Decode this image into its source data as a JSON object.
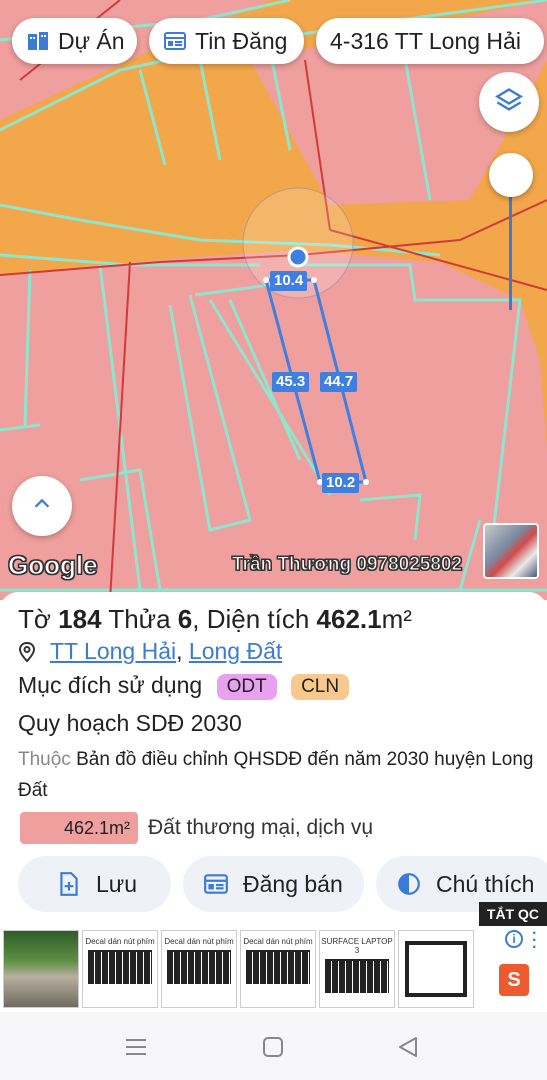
{
  "chips": [
    {
      "label": "Dự Án",
      "icon": "buildings-icon"
    },
    {
      "label": "Tin Đăng",
      "icon": "listing-icon"
    },
    {
      "label": "4-316 TT Long Hải"
    }
  ],
  "map": {
    "dimensions": {
      "top": "10.4",
      "left": "45.3",
      "right": "44.7",
      "bottom": "10.2"
    },
    "google_label": "Google",
    "watermark": "Trần Thương 0978025802",
    "colors": {
      "residential_zone": "#ef9f9d",
      "agricultural_zone": "#f2a74a",
      "parcel_outline": "#8fe6cf",
      "selection": "#3f7fe0"
    }
  },
  "parcel": {
    "to_label": "Tờ",
    "to": "184",
    "thua_label": "Thửa",
    "thua": "6",
    "dien_tich_label": ", Diện tích",
    "area": "462.1",
    "area_unit": "m²",
    "ward": "TT Long Hải",
    "address_sep": ", ",
    "district": "Long Đất",
    "muc_dich_label": "Mục đích sử dụng",
    "tags": [
      "ODT",
      "CLN"
    ],
    "plan_title": "Quy hoạch SDĐ 2030",
    "thuoc_label": "Thuộc",
    "plan_source": "Bản đồ điều chỉnh QHSDĐ đến năm 2030 huyện Long Đất",
    "usage_area": "462.1m²",
    "usage_desc": "Đất thương mại, dịch vụ"
  },
  "actions": [
    "Lưu",
    "Đăng bán",
    "Chú thích"
  ],
  "ad": {
    "close_label": "TẮT QC",
    "items": [
      "Decal dán nút phím",
      "Decal dán nút phím",
      "Decal dán nút phím",
      "SURFACE LAPTOP 3"
    ]
  }
}
